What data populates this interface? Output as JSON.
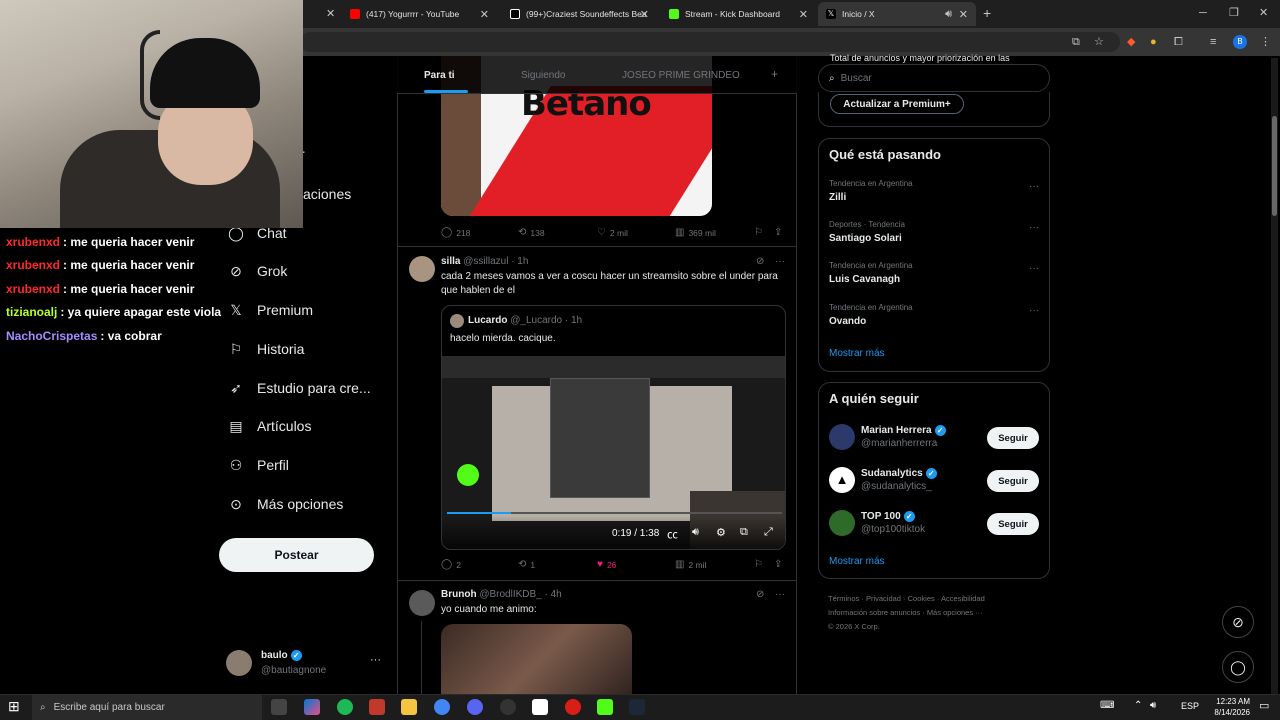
{
  "tabs": [
    {
      "label": "(417) Yogurrrr - YouTube",
      "color": "#ff0000"
    },
    {
      "label": "(99+)Craziest Soundeffects Beat",
      "color": "#ffffff"
    },
    {
      "label": "Stream - Kick Dashboard",
      "color": "#53fc18"
    },
    {
      "label": "Inicio / X",
      "color": "#ffffff"
    }
  ],
  "chat": [
    {
      "user": "xrubenxd",
      "msg": ": me queria hacer venir",
      "color": "#ff2b2b"
    },
    {
      "user": "xrubenxd",
      "msg": ": me queria hacer venir",
      "color": "#ff2b2b"
    },
    {
      "user": "xrubenxd",
      "msg": ": me queria hacer venir",
      "color": "#ff2b2b"
    },
    {
      "user": "tizianoalj",
      "msg": ": ya quiere apagar este viola",
      "color": "#b8ff2b"
    },
    {
      "user": "NachoCrispetas",
      "msg": ": va cobrar",
      "color": "#a78bff"
    }
  ],
  "nav": {
    "partial_1": "r",
    "partial_2": "aciones",
    "items": [
      "Chat",
      "Grok",
      "Premium",
      "Historia",
      "Estudio para cre...",
      "Artículos",
      "Perfil",
      "Más opciones"
    ],
    "post": "Postear",
    "user_name": "baulo",
    "user_handle": "@bautiagnone"
  },
  "feed": {
    "tabs": [
      "Para ti",
      "Siguiendo",
      "JOSEO PRIME GRINDEO"
    ],
    "jersey_text": "Betano",
    "tweet0_actions": [
      "218",
      "138",
      "2 mil",
      "369 mil"
    ],
    "tweet1": {
      "name": "silla",
      "handle": "@ssillazul · 1h",
      "text": "cada 2 meses vamos a ver a coscu hacer un streamsito sobre el under para que hablen de el",
      "quote_name": "Lucardo",
      "quote_handle": "@_Lucardo · 1h",
      "quote_text": "hacelo mierda. cacique.",
      "video_time": "0:19 / 1:38",
      "actions": [
        "2",
        "1",
        "26",
        "2 mil"
      ]
    },
    "tweet2": {
      "name": "Brunoh",
      "handle": "@BrodlIKDB_ · 4h",
      "text": "yo cuando me animo:"
    }
  },
  "right": {
    "search_placeholder": "Buscar",
    "premium_cut": "Total de anuncios y mayor priorización en las",
    "premium_btn": "Actualizar a Premium+",
    "trends_title": "Qué está pasando",
    "trends": [
      {
        "ctx": "Tendencia en Argentina",
        "name": "Zilli"
      },
      {
        "ctx": "Deportes · Tendencia",
        "name": "Santiago Solari"
      },
      {
        "ctx": "Tendencia en Argentina",
        "name": "Luis Cavanagh"
      },
      {
        "ctx": "Tendencia en Argentina",
        "name": "Ovando"
      }
    ],
    "show_more": "Mostrar más",
    "follow_title": "A quién seguir",
    "follow": [
      {
        "name": "Marian Herrera",
        "handle": "@marianherrerra",
        "btn": "Seguir"
      },
      {
        "name": "Sudanalytics",
        "handle": "@sudanalytics_",
        "btn": "Seguir"
      },
      {
        "name": "TOP 100",
        "handle": "@top100tiktok",
        "btn": "Seguir"
      }
    ],
    "footer": [
      "Términos",
      "Privacidad",
      "Cookies",
      "Accesibilidad",
      "Información sobre anuncios",
      "Más opciones ···",
      "© 2026 X Corp."
    ]
  },
  "taskbar": {
    "search": "Escribe aquí para buscar",
    "lang": "ESP",
    "time": "12:23 AM",
    "date": "8/14/2026"
  }
}
